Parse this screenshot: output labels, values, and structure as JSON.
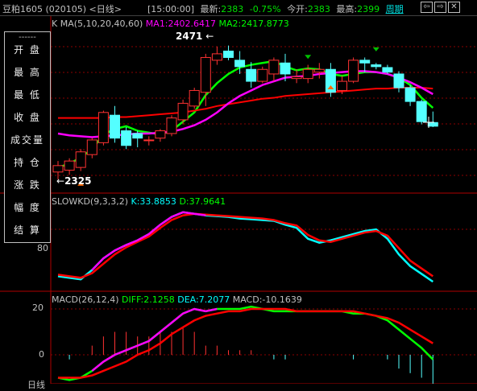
{
  "titlebar": {
    "title": "豆粕1605 (020105) <日线>",
    "time": "[15:00:00]",
    "latest_label": "最新:",
    "latest_value": "2383",
    "change": "-0.75%",
    "open_label": "今开:",
    "open_value": "2383",
    "high_label": "最高:",
    "high_value": "2399",
    "period_link": "周期",
    "buttons": [
      "⇦",
      "⇨",
      "✕"
    ]
  },
  "kline": {
    "header": "K  MA(5,10,20,40,60)",
    "ma1": "MA1:2402.6417",
    "ma2": "MA2:2417.8773",
    "high_label": "2471",
    "low_label": "2325"
  },
  "stoch": {
    "header": "SLOWKD(9,3,3,2)",
    "k": "K:33.8853",
    "d": "D:37.9641",
    "axis_label": "80"
  },
  "macd": {
    "header": "MACD(26,12,4)",
    "diff": "DIFF:2.1258",
    "dea": "DEA:7.2077",
    "macd": "MACD:-10.1639",
    "y_ticks": [
      "20",
      "0"
    ],
    "bottom_label": "日线"
  },
  "panel": {
    "dashes": "------",
    "rows": [
      "开 盘",
      "最 高",
      "最 低",
      "收 盘",
      "成交量",
      "持 仓",
      "涨 跌",
      "幅 度",
      "结 算"
    ]
  },
  "colors": {
    "up": "#ff3232",
    "down": "#54ffff",
    "ma1": "#ff00ff",
    "ma2": "#00ff00",
    "ma3": "#ff0000",
    "grid": "#8b0000",
    "highlight_value": "#00e000",
    "down_text": "#00e000"
  },
  "chart_data": {
    "type": "candlestick",
    "series": [
      {
        "name": "K",
        "ohlc": [
          [
            2333,
            2345,
            2325,
            2340
          ],
          [
            2335,
            2348,
            2330,
            2345
          ],
          [
            2338,
            2358,
            2334,
            2355
          ],
          [
            2352,
            2370,
            2348,
            2368
          ],
          [
            2365,
            2400,
            2362,
            2398
          ],
          [
            2395,
            2405,
            2365,
            2370
          ],
          [
            2378,
            2382,
            2358,
            2362
          ],
          [
            2375,
            2378,
            2360,
            2370
          ],
          [
            2368,
            2372,
            2362,
            2368
          ],
          [
            2370,
            2380,
            2366,
            2378
          ],
          [
            2375,
            2395,
            2372,
            2392
          ],
          [
            2390,
            2412,
            2385,
            2408
          ],
          [
            2405,
            2425,
            2402,
            2422
          ],
          [
            2420,
            2462,
            2405,
            2458
          ],
          [
            2455,
            2470,
            2450,
            2462
          ],
          [
            2465,
            2471,
            2455,
            2458
          ],
          [
            2455,
            2465,
            2440,
            2448
          ],
          [
            2445,
            2453,
            2425,
            2432
          ],
          [
            2432,
            2448,
            2430,
            2445
          ],
          [
            2440,
            2458,
            2432,
            2455
          ],
          [
            2452,
            2462,
            2432,
            2440
          ],
          [
            2435,
            2445,
            2430,
            2437
          ],
          [
            2435,
            2450,
            2430,
            2445
          ],
          [
            2442,
            2452,
            2435,
            2445
          ],
          [
            2445,
            2452,
            2415,
            2420
          ],
          [
            2422,
            2438,
            2418,
            2432
          ],
          [
            2432,
            2458,
            2430,
            2455
          ],
          [
            2455,
            2458,
            2442,
            2452
          ],
          [
            2450,
            2452,
            2445,
            2448
          ],
          [
            2447,
            2450,
            2440,
            2442
          ],
          [
            2440,
            2443,
            2420,
            2425
          ],
          [
            2425,
            2428,
            2405,
            2410
          ],
          [
            2410,
            2412,
            2385,
            2388
          ],
          [
            2387,
            2399,
            2382,
            2383
          ]
        ]
      },
      {
        "name": "MA1",
        "values": [
          2338,
          2342,
          2349,
          2358,
          2374,
          2380,
          2383,
          2378,
          2376,
          2374,
          2378,
          2388,
          2398,
          2417,
          2430,
          2440,
          2447,
          2450,
          2452,
          2454,
          2448,
          2444,
          2446,
          2445,
          2440,
          2438,
          2440,
          2442,
          2442,
          2440,
          2436,
          2428,
          2414,
          2403
        ]
      },
      {
        "name": "MA2",
        "values": [
          2375,
          2373,
          2372,
          2371,
          2372,
          2373,
          2374,
          2375,
          2375,
          2376,
          2377,
          2380,
          2384,
          2390,
          2398,
          2408,
          2416,
          2422,
          2428,
          2432,
          2436,
          2437,
          2438,
          2440,
          2441,
          2442,
          2443,
          2443,
          2442,
          2440,
          2436,
          2431,
          2425,
          2418
        ]
      },
      {
        "name": "MA3",
        "values": [
          2392,
          2392,
          2392,
          2392,
          2392,
          2393,
          2393,
          2394,
          2395,
          2396,
          2397,
          2398,
          2400,
          2402,
          2405,
          2407,
          2409,
          2411,
          2413,
          2414,
          2416,
          2417,
          2418,
          2419,
          2420,
          2421,
          2422,
          2423,
          2424,
          2424,
          2425,
          2425,
          2425,
          2424
        ]
      }
    ],
    "stoch_k": [
      12,
      10,
      8,
      20,
      35,
      45,
      52,
      58,
      66,
      78,
      88,
      94,
      92,
      90,
      89,
      88,
      86,
      85,
      84,
      83,
      78,
      74,
      60,
      55,
      58,
      62,
      66,
      70,
      72,
      60,
      40,
      25,
      15,
      5
    ],
    "stoch_d": [
      14,
      12,
      10,
      16,
      28,
      40,
      49,
      56,
      63,
      74,
      84,
      90,
      92,
      91,
      90,
      89,
      88,
      87,
      86,
      84,
      80,
      77,
      65,
      58,
      56,
      60,
      64,
      68,
      70,
      64,
      48,
      32,
      22,
      12
    ],
    "macd_diff": [
      -10,
      -11,
      -10,
      -7,
      -3,
      0,
      2,
      4,
      6,
      10,
      14,
      18,
      20,
      19,
      20,
      20,
      20,
      21,
      20,
      19,
      19,
      19,
      19,
      19,
      19,
      19,
      18,
      18,
      17,
      15,
      11,
      7,
      3,
      -2
    ],
    "macd_dea": [
      -10,
      -10,
      -10,
      -9,
      -7,
      -5,
      -3,
      0,
      2,
      5,
      9,
      12,
      15,
      17,
      18,
      19,
      19,
      20,
      20,
      20,
      20,
      19,
      19,
      19,
      19,
      19,
      19,
      18,
      17,
      16,
      14,
      11,
      8,
      5
    ],
    "ylim_kline": [
      2310,
      2490
    ]
  }
}
